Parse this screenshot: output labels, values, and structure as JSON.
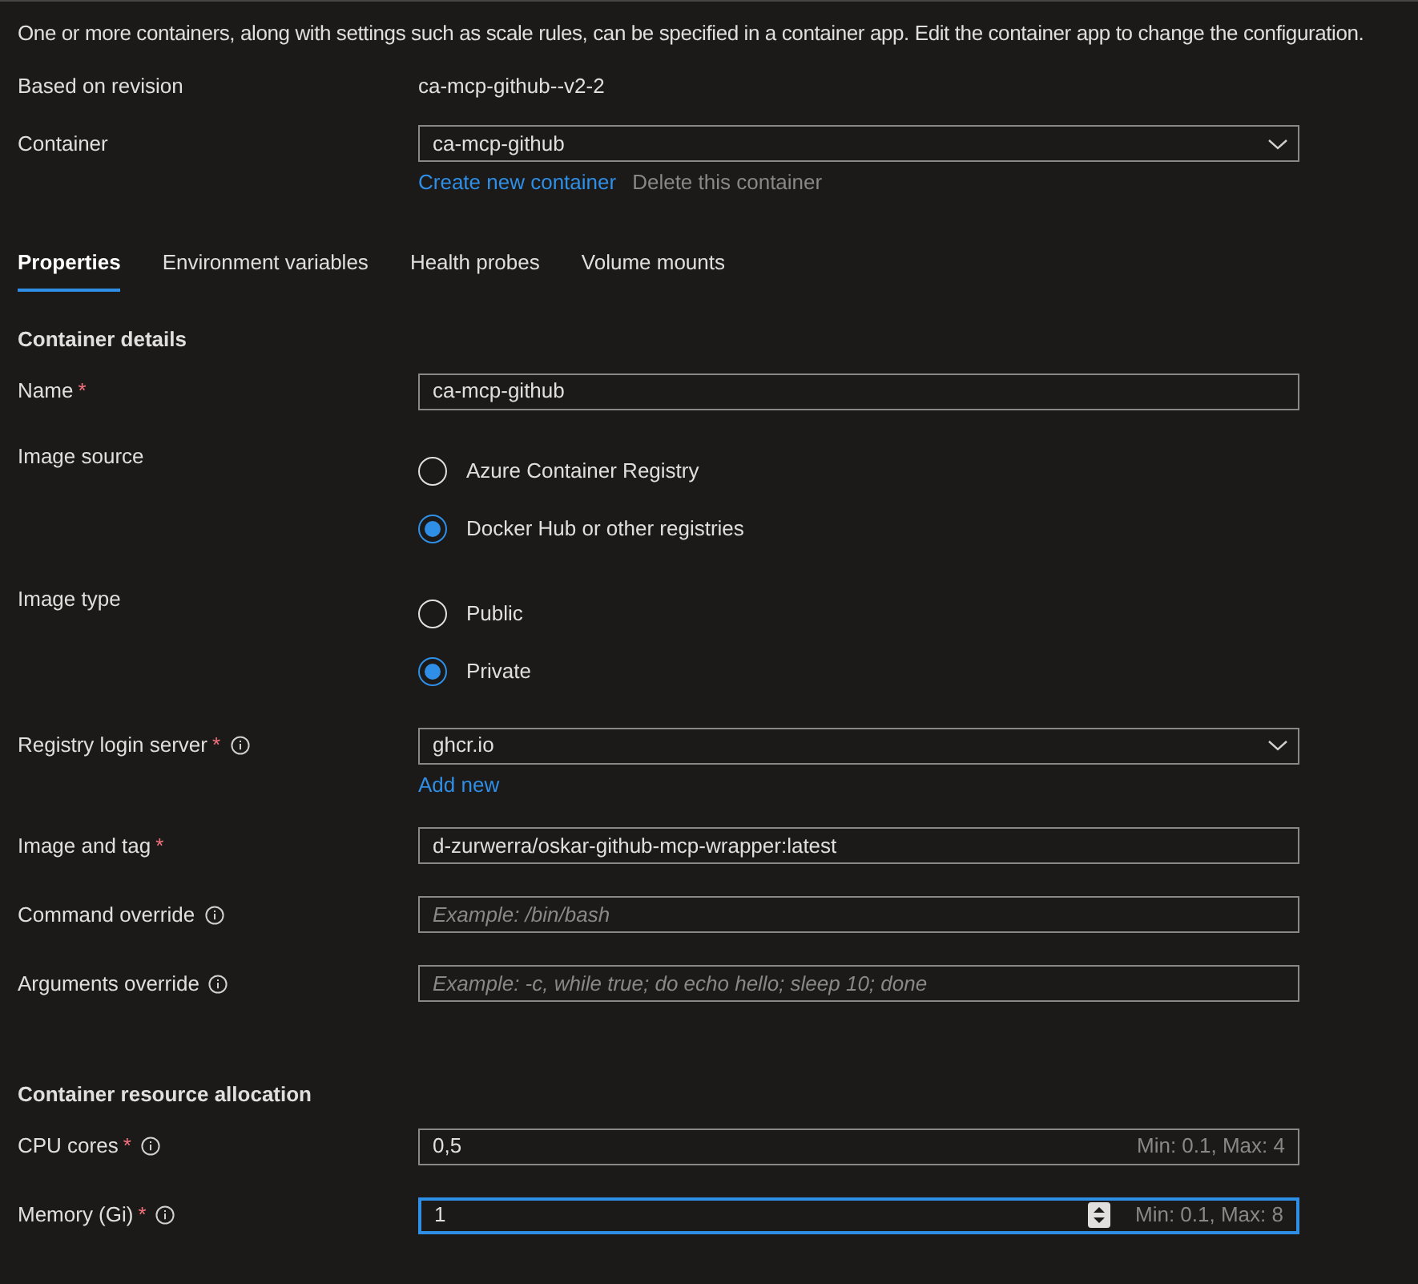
{
  "description": "One or more containers, along with settings such as scale rules, can be specified in a container app. Edit the container app to change the configuration.",
  "revision": {
    "label": "Based on revision",
    "value": "ca-mcp-github--v2-2"
  },
  "container": {
    "label": "Container",
    "value": "ca-mcp-github",
    "links": [
      {
        "text": "Create new container",
        "disabled": false
      },
      {
        "text": "Delete this container",
        "disabled": true
      }
    ]
  },
  "tabs": [
    {
      "label": "Properties",
      "selected": true
    },
    {
      "label": "Environment variables",
      "selected": false
    },
    {
      "label": "Health probes",
      "selected": false
    },
    {
      "label": "Volume mounts",
      "selected": false
    }
  ],
  "sections": [
    {
      "heading": "Container details",
      "fields": [
        {
          "kind": "input",
          "label": "Name",
          "required": "*",
          "info": false,
          "value": "ca-mcp-github"
        },
        {
          "kind": "radio",
          "label": "Image source",
          "options": [
            {
              "label": "Azure Container Registry",
              "selected": false
            },
            {
              "label": "Docker Hub or other registries",
              "selected": true
            }
          ]
        },
        {
          "kind": "radio",
          "label": "Image type",
          "options": [
            {
              "label": "Public",
              "selected": false
            },
            {
              "label": "Private",
              "selected": true
            }
          ]
        },
        {
          "kind": "dropdown",
          "label": "Registry login server",
          "required": "*",
          "info": true,
          "value": "ghcr.io",
          "link": "Add new"
        },
        {
          "kind": "input",
          "label": "Image and tag",
          "required": "*",
          "info": false,
          "value": "d-zurwerra/oskar-github-mcp-wrapper:latest"
        },
        {
          "kind": "input",
          "label": "Command override",
          "info": true,
          "placeholder": "Example: /bin/bash"
        },
        {
          "kind": "input",
          "label": "Arguments override",
          "info": true,
          "placeholder": "Example: -c, while true; do echo hello; sleep 10; done"
        }
      ]
    },
    {
      "heading": "Container resource allocation",
      "fields": [
        {
          "kind": "input",
          "label": "CPU cores",
          "required": "*",
          "info": true,
          "value": "0,5",
          "hint": "Min: 0.1, Max: 4",
          "focused": false
        },
        {
          "kind": "input",
          "label": "Memory (Gi)",
          "required": "*",
          "info": true,
          "value": "1",
          "hint": "Min: 0.1, Max: 8",
          "focused": true,
          "spinner": true
        }
      ]
    }
  ]
}
